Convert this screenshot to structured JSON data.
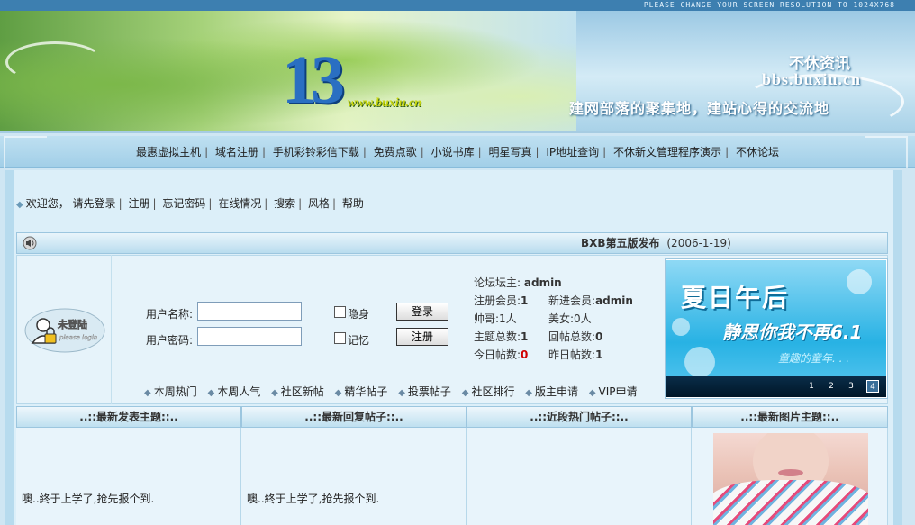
{
  "top_hint": "PLEASE CHANGE YOUR SCREEN RESOLUTION TO 1024X768",
  "banner": {
    "logo_text": "13",
    "logo_url": "www.buxiu.cn",
    "site_name": "不休资讯",
    "site_url": "bbs.buxiu.cn",
    "slogan": "建网部落的聚集地，建站心得的交流地"
  },
  "nav": {
    "items": [
      "最惠虚拟主机",
      "域名注册",
      "手机彩铃彩信下载",
      "免费点歌",
      "小说书库",
      "明星写真",
      "IP地址查询",
      "不休新文管理程序演示",
      "不休论坛"
    ]
  },
  "userbar": {
    "welcome": "欢迎您，",
    "items": [
      "请先登录",
      "注册",
      "忘记密码",
      "在线情况",
      "搜索",
      "风格",
      "帮助"
    ]
  },
  "announcement": {
    "title": "BXB第五版发布",
    "date": "(2006-1-19)"
  },
  "avatar": {
    "label": "未登陆",
    "sub": "please login"
  },
  "login": {
    "username_label": "用户名称:",
    "password_label": "用户密码:",
    "username_value": "",
    "password_value": "",
    "hide_label": "隐身",
    "remember_label": "记忆",
    "login_button": "登录",
    "register_button": "注册"
  },
  "quick_links": [
    "本周热门",
    "本周人气",
    "社区新帖",
    "精华帖子",
    "投票帖子",
    "社区排行",
    "版主申请",
    "VIP申请"
  ],
  "stats": {
    "admin_label": "论坛坛主:",
    "admin_value": "admin",
    "members_label": "注册会员:",
    "members_value": "1",
    "newest_label": "新进会员:",
    "newest_value": "admin",
    "male_label": "帅哥:",
    "male_value": "1人",
    "female_label": "美女:",
    "female_value": "0人",
    "topics_label": "主题总数:",
    "topics_value": "1",
    "replies_label": "回帖总数:",
    "replies_value": "0",
    "today_label": "今日帖数:",
    "today_value": "0",
    "yesterday_label": "昨日帖数:",
    "yesterday_value": "1"
  },
  "promo": {
    "line1": "夏日午后",
    "line2": "静思你我不再6.1",
    "line3": "童趣的童年. . .",
    "pages": [
      "1",
      "2",
      "3",
      "4"
    ],
    "active_page": 4
  },
  "columns": [
    {
      "title": "..::最新发表主题::..",
      "item": "噢..終于上学了,抢先报个到."
    },
    {
      "title": "..::最新回复帖子::..",
      "item": "噢..終于上学了,抢先报个到."
    },
    {
      "title": "..::近段热门帖子::..",
      "item": ""
    },
    {
      "title": "..::最新图片主题::..",
      "item": ""
    }
  ],
  "colors": {
    "accent": "#3d7fb0",
    "nav_bg": "#a2cfe8",
    "panel_bg": "#e6f3fa",
    "red": "#d00000"
  }
}
